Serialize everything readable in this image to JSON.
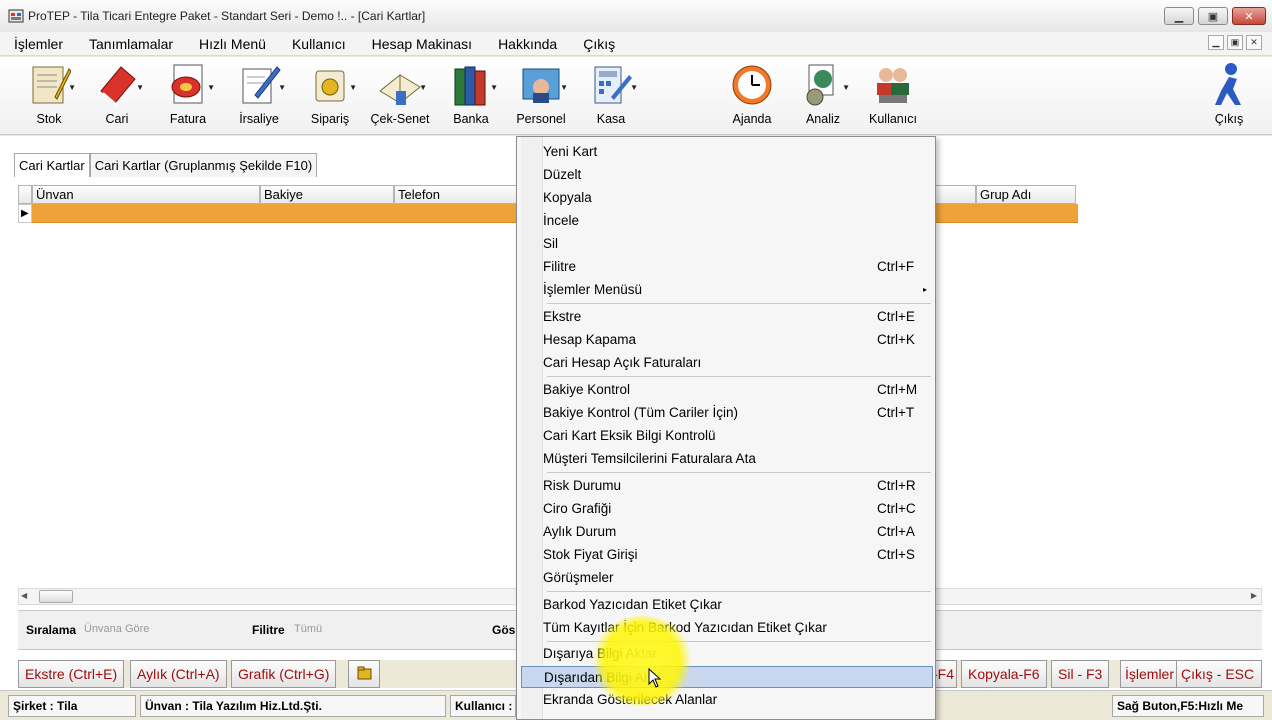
{
  "window": {
    "title": "ProTEP - Tila Ticari Entegre Paket - Standart Seri - Demo !.. - [Cari Kartlar]",
    "minimize": "▁",
    "restore": "▣",
    "close": "✕",
    "mdi_minimize": "▁",
    "mdi_restore": "▣",
    "mdi_close": "✕"
  },
  "menubar": {
    "items": [
      "İşlemler",
      "Tanımlamalar",
      "Hızlı Menü",
      "Kullanıcı",
      "Hesap Makinası",
      "Hakkında",
      "Çıkış"
    ]
  },
  "toolbar": {
    "tools": [
      {
        "label": "Stok"
      },
      {
        "label": "Cari"
      },
      {
        "label": "Fatura"
      },
      {
        "label": "İrsaliye"
      },
      {
        "label": "Sipariş"
      },
      {
        "label": "Çek-Senet"
      },
      {
        "label": "Banka"
      },
      {
        "label": "Personel"
      },
      {
        "label": "Kasa"
      },
      {
        "label": "Ajanda"
      },
      {
        "label": "Analiz"
      },
      {
        "label": "Kullanıcı"
      },
      {
        "label": "Çıkış"
      }
    ]
  },
  "tabs": [
    "Cari Kartlar",
    "Cari Kartlar (Gruplanmış Şekilde F10)"
  ],
  "grid": {
    "columns": [
      "Ünvan",
      "Bakiye",
      "Telefon",
      "Grup Adı"
    ]
  },
  "filterbar": {
    "sort_label": "Sıralama",
    "sort_value": "Ünvana Göre",
    "filter_label": "Filitre",
    "filter_value": "Tümü",
    "show_label": "Gös"
  },
  "buttons": {
    "left": [
      "Ekstre (Ctrl+E)",
      "Aylık (Ctrl+A)",
      "Grafik (Ctrl+G)"
    ],
    "right": [
      "-F4",
      "Kopyala-F6",
      "Sil - F3",
      "İşlemler",
      "Çıkış - ESC"
    ]
  },
  "statusbar": {
    "company": "Şirket : Tila",
    "title": "Ünvan : Tila Yazılım Hiz.Ltd.Şti.",
    "user": "Kullanıcı :",
    "hint": "Sağ Buton,F5:Hızlı Me"
  },
  "context_menu": {
    "items": [
      {
        "label": "Yeni Kart",
        "key": ""
      },
      {
        "label": "Düzelt",
        "key": ""
      },
      {
        "label": "Kopyala",
        "key": ""
      },
      {
        "label": "İncele",
        "key": ""
      },
      {
        "label": "Sil",
        "key": ""
      },
      {
        "label": "Filitre",
        "key": "Ctrl+F"
      },
      {
        "label": "İşlemler Menüsü",
        "key": ""
      },
      {
        "label": "Ekstre",
        "key": "Ctrl+E"
      },
      {
        "label": "Hesap Kapama",
        "key": "Ctrl+K"
      },
      {
        "label": "Cari Hesap Açık Faturaları",
        "key": ""
      },
      {
        "label": "Bakiye Kontrol",
        "key": "Ctrl+M"
      },
      {
        "label": "Bakiye Kontrol (Tüm Cariler İçin)",
        "key": "Ctrl+T"
      },
      {
        "label": "Cari Kart Eksik Bilgi Kontrolü",
        "key": ""
      },
      {
        "label": "Müşteri Temsilcilerini Faturalara Ata",
        "key": ""
      },
      {
        "label": "Risk Durumu",
        "key": "Ctrl+R"
      },
      {
        "label": "Ciro Grafiği",
        "key": "Ctrl+C"
      },
      {
        "label": "Aylık Durum",
        "key": "Ctrl+A"
      },
      {
        "label": "Stok Fiyat Girişi",
        "key": "Ctrl+S"
      },
      {
        "label": "Görüşmeler",
        "key": ""
      },
      {
        "label": "Barkod Yazıcıdan Etiket Çıkar",
        "key": ""
      },
      {
        "label": "Tüm Kayıtlar İçin Barkod Yazıcıdan Etiket Çıkar",
        "key": ""
      },
      {
        "label": "Dışarıya Bilgi Aktar",
        "key": ""
      },
      {
        "label": "Dışarıdan Bilgi Al",
        "key": ""
      },
      {
        "label": "Ekranda Gösterilecek Alanlar",
        "key": ""
      }
    ],
    "submenu_arrow": "▸"
  },
  "colors": {
    "selected_row": "#f0a23a",
    "button_text": "#9c0d0d",
    "highlight": "#c8d7ee",
    "cursor_glow": "#fff528"
  }
}
